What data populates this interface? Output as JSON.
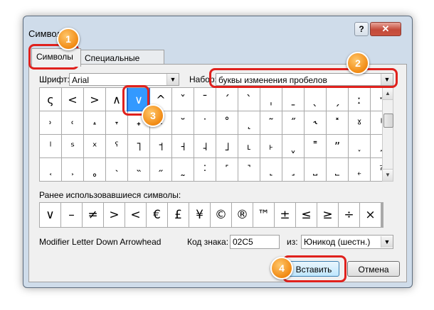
{
  "window": {
    "title": "Символ",
    "help_label": "?",
    "close_label": "✕"
  },
  "tabs": [
    {
      "label": "Символы",
      "active": true
    },
    {
      "label": "Специальные знаки",
      "active": false
    }
  ],
  "font": {
    "label": "Шрифт:",
    "value": "Arial"
  },
  "subset": {
    "label": "Набор:",
    "value": "буквы изменения пробелов"
  },
  "grid": {
    "rows": [
      [
        "ς",
        "<",
        ">",
        "∧",
        "∨",
        "^",
        "ˇ",
        "ˉ",
        "ˊ",
        "ˋ",
        "ˌ",
        "ˍ",
        "ˎ",
        "ˏ",
        "ː",
        "ˑ"
      ],
      [
        "˒",
        "˓",
        "˔",
        "˕",
        "˖",
        "˗",
        "˘",
        "˙",
        "˚",
        "˛",
        "˜",
        "˝",
        "˞",
        "˟",
        "ˠ",
        "ˡ"
      ],
      [
        "ˡ",
        "ˢ",
        "ˣ",
        "ˤ",
        "˥",
        "˦",
        "˧",
        "˨",
        "˩",
        "˪",
        "˫",
        "ˬ",
        "˭",
        "ˮ",
        "˯",
        "˰"
      ],
      [
        "˱",
        "˲",
        "˳",
        "˴",
        "˵",
        "˶",
        "˷",
        "˸",
        "˹",
        "˺",
        "˻",
        "˼",
        "˽",
        "˾",
        "˿",
        "ˀ"
      ]
    ],
    "selected": "∨"
  },
  "recent": {
    "label": "Ранее использовавшиеся символы:",
    "symbols": [
      "∨",
      "–",
      "≠",
      ">",
      "<",
      "€",
      "£",
      "¥",
      "©",
      "®",
      "™",
      "±",
      "≤",
      "≥",
      "÷",
      "×"
    ]
  },
  "char_name": "Modifier Letter Down Arrowhead",
  "code": {
    "label": "Код знака:",
    "value": "02C5"
  },
  "from": {
    "label": "из:",
    "value": "Юникод (шестн.)"
  },
  "buttons": {
    "insert": "Вставить",
    "cancel": "Отмена"
  },
  "annotations": {
    "b1": "1",
    "b2": "2",
    "b3": "3",
    "b4": "4",
    "accent": "#e0211d",
    "badge": "#f18a13"
  }
}
